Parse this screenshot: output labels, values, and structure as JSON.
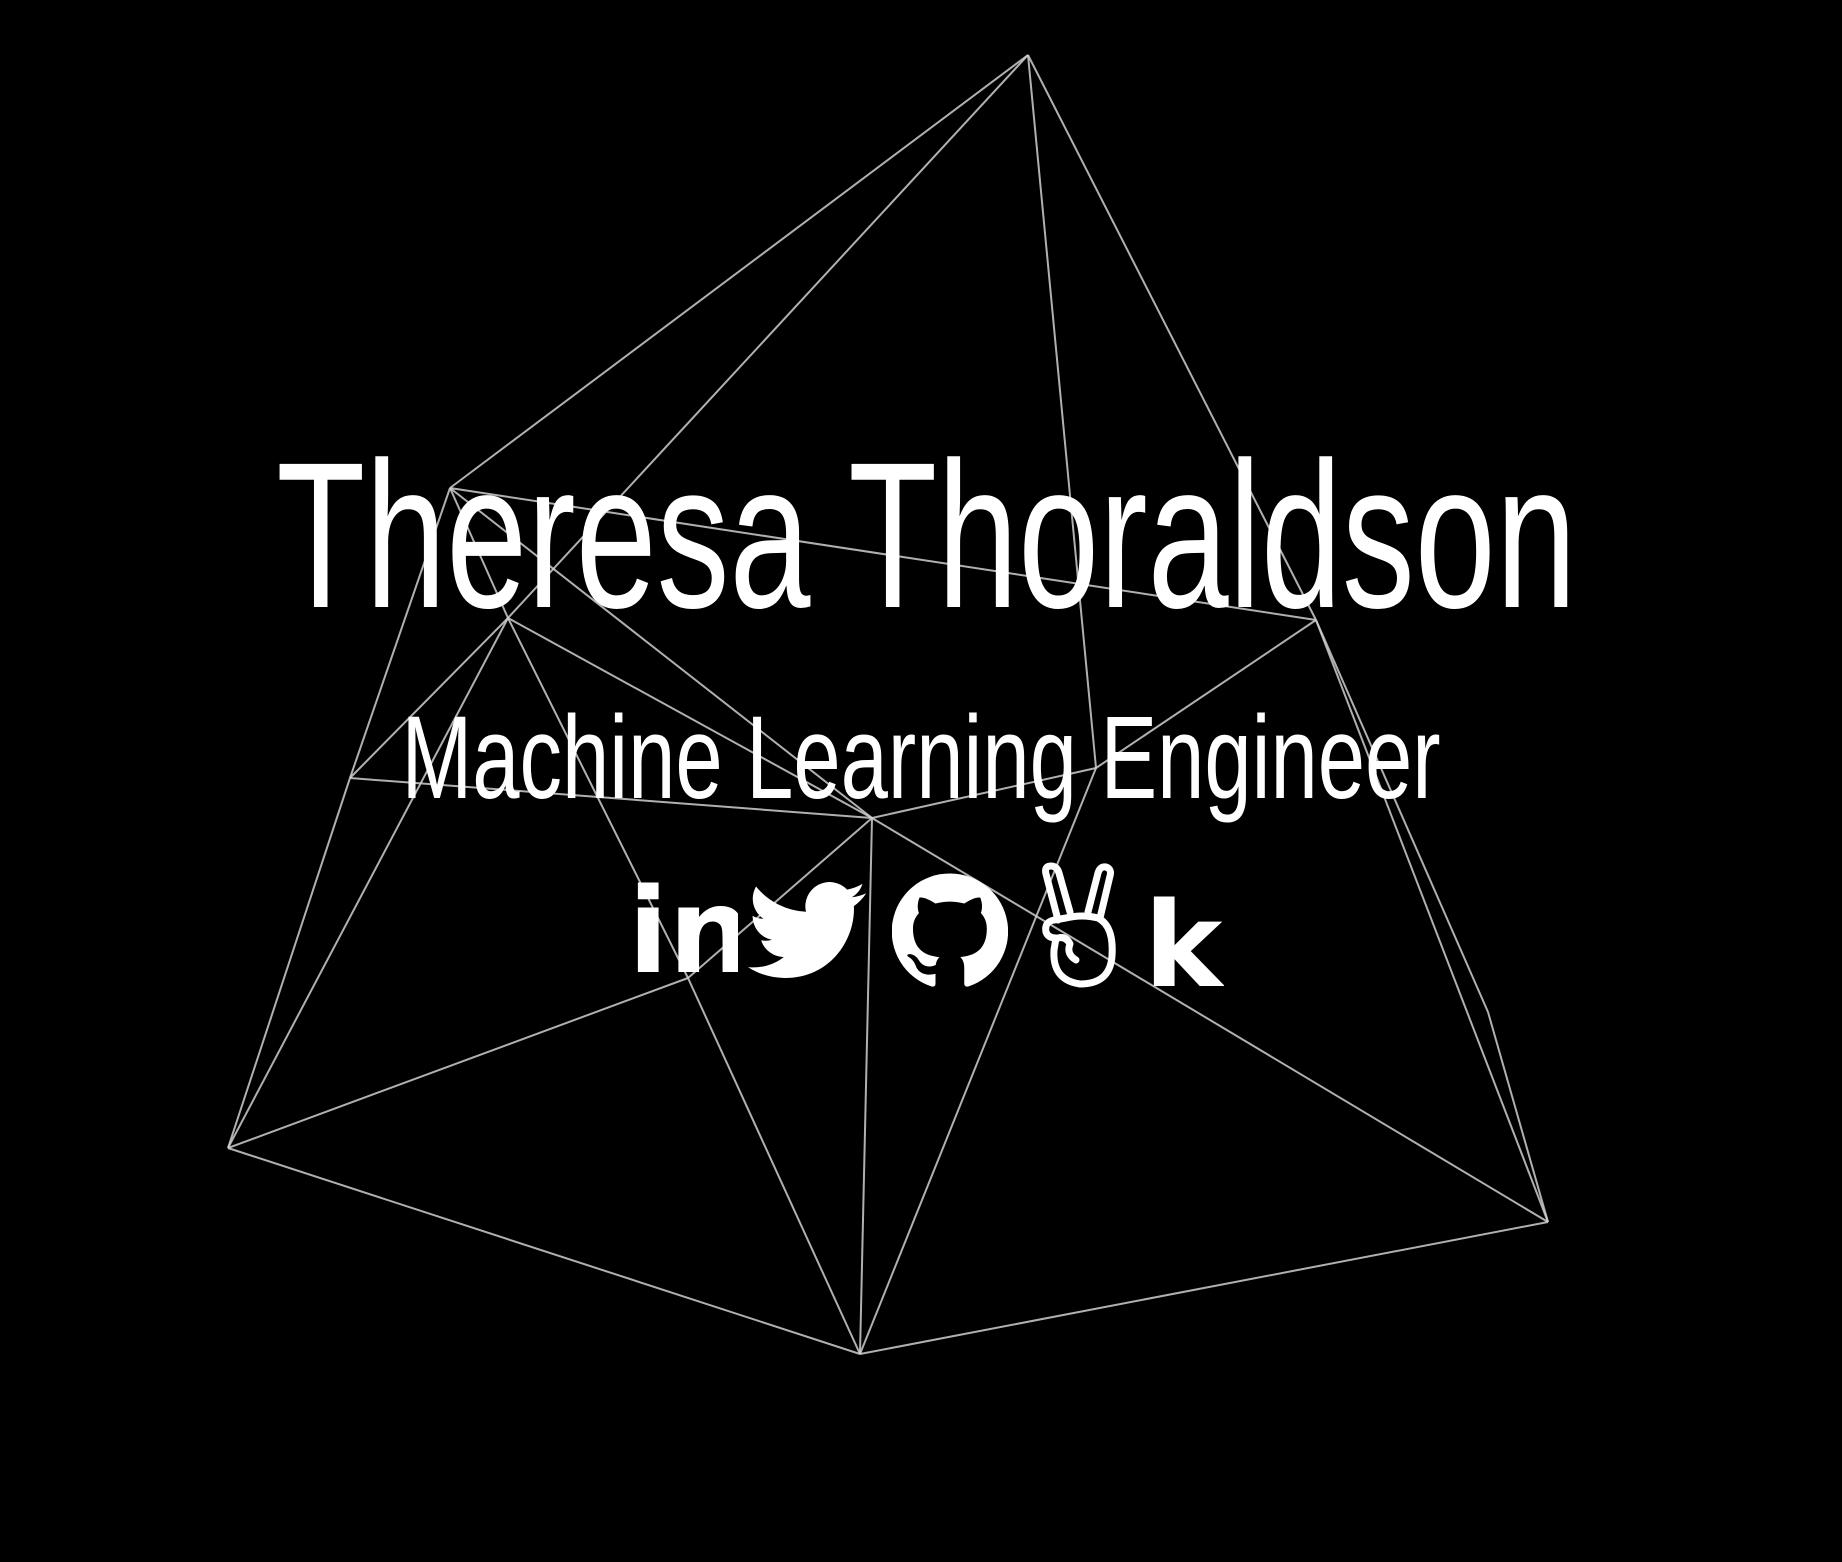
{
  "profile": {
    "name": "Theresa Thoraldson",
    "title": "Machine Learning Engineer"
  },
  "social_links": [
    {
      "icon": "linkedin-icon",
      "text": "in"
    },
    {
      "icon": "twitter-icon"
    },
    {
      "icon": "github-icon"
    },
    {
      "icon": "angellist-icon"
    },
    {
      "icon": "kaggle-icon",
      "text": "k"
    }
  ],
  "colors": {
    "background": "#000000",
    "text": "#ffffff",
    "mesh": "#cfcfcf"
  }
}
